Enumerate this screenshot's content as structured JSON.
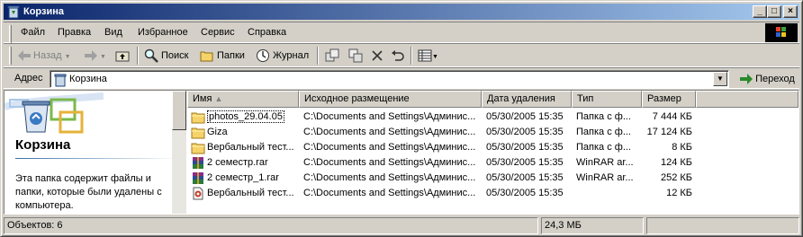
{
  "window": {
    "title": "Корзина"
  },
  "menu": [
    "Файл",
    "Правка",
    "Вид",
    "Избранное",
    "Сервис",
    "Справка"
  ],
  "toolbar": {
    "back": "Назад",
    "search": "Поиск",
    "folders": "Папки",
    "history": "Журнал"
  },
  "address": {
    "label": "Адрес",
    "value": "Корзина",
    "go": "Переход"
  },
  "leftpane": {
    "title": "Корзина",
    "description": "Эта папка содержит файлы и папки, которые были удалены с компьютера."
  },
  "columns": [
    "Имя",
    "Исходное размещение",
    "Дата удаления",
    "Тип",
    "Размер"
  ],
  "files": [
    {
      "name": "photos_29.04.05",
      "location": "C:\\Documents and Settings\\Админис...",
      "date": "05/30/2005 15:35",
      "type": "Папка с ф...",
      "size": "7 444 КБ",
      "icon": "folder-icon"
    },
    {
      "name": "Giza",
      "location": "C:\\Documents and Settings\\Админис...",
      "date": "05/30/2005 15:35",
      "type": "Папка с ф...",
      "size": "17 124 КБ",
      "icon": "folder-icon"
    },
    {
      "name": "Вербальный тест...",
      "location": "C:\\Documents and Settings\\Админис...",
      "date": "05/30/2005 15:35",
      "type": "Папка с ф...",
      "size": "8 КБ",
      "icon": "folder-icon"
    },
    {
      "name": "2 семестр.rar",
      "location": "C:\\Documents and Settings\\Админис...",
      "date": "05/30/2005 15:35",
      "type": "WinRAR ar...",
      "size": "124 КБ",
      "icon": "rar-archive-icon"
    },
    {
      "name": "2 семестр_1.rar",
      "location": "C:\\Documents and Settings\\Админис...",
      "date": "05/30/2005 15:35",
      "type": "WinRAR ar...",
      "size": "252 КБ",
      "icon": "rar-archive-icon"
    },
    {
      "name": "Вербальный тест...",
      "location": "C:\\Documents and Settings\\Админис...",
      "date": "05/30/2005 15:35",
      "type": "",
      "size": "12 КБ",
      "icon": "document-icon"
    }
  ],
  "status": {
    "objects": "Объектов: 6",
    "size": "24,3 МБ"
  }
}
